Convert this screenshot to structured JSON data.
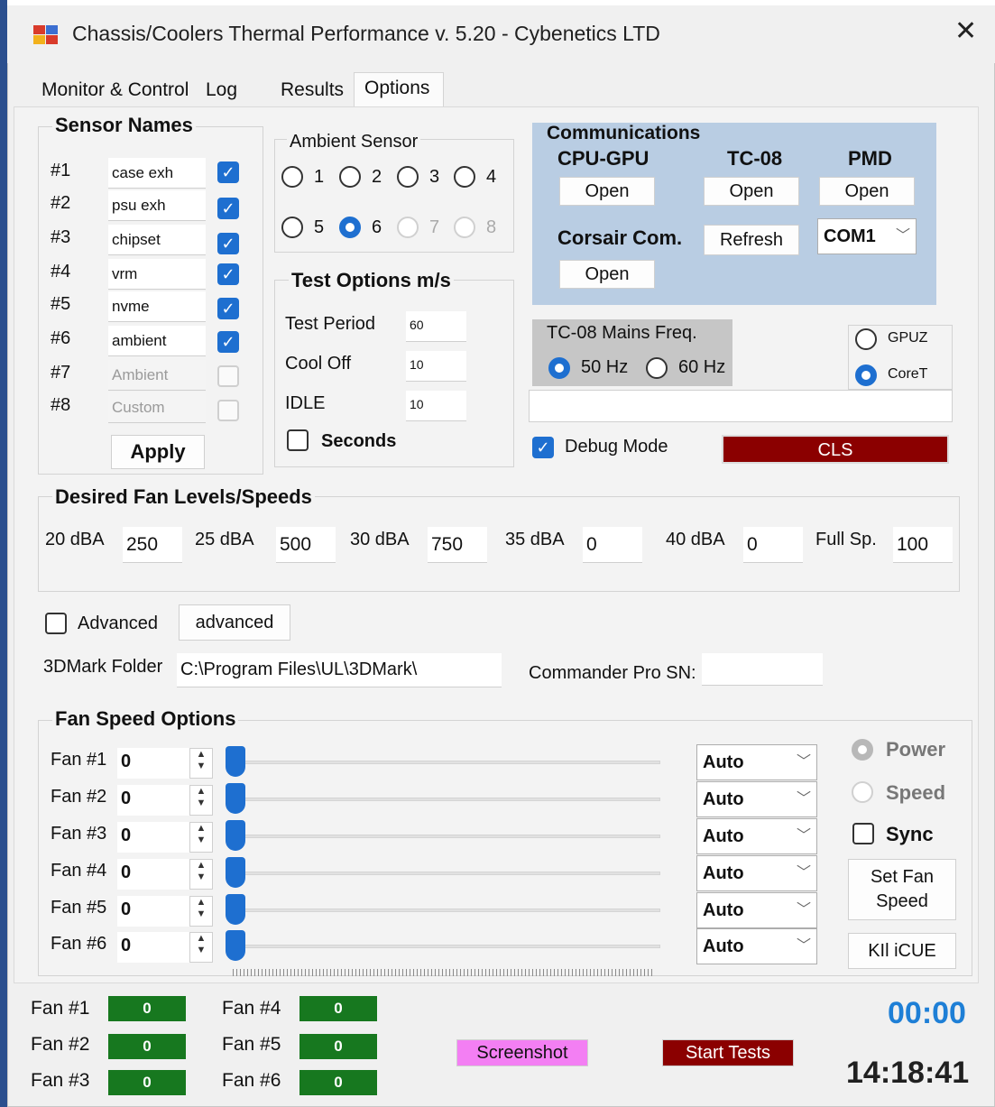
{
  "window": {
    "title": "Chassis/Coolers Thermal Performance v. 5.20 - Cybenetics LTD",
    "app_icon": "app-window-icon",
    "close_glyph": "✕"
  },
  "tabs": [
    "Monitor & Control",
    "Log",
    "Results",
    "Options"
  ],
  "active_tab": "Options",
  "sensor_names": {
    "title": "Sensor Names",
    "rows": [
      {
        "num": "#1",
        "value": "case exh",
        "checked": true
      },
      {
        "num": "#2",
        "value": "psu exh",
        "checked": true
      },
      {
        "num": "#3",
        "value": "chipset",
        "checked": true
      },
      {
        "num": "#4",
        "value": "vrm",
        "checked": true
      },
      {
        "num": "#5",
        "value": "nvme",
        "checked": true
      },
      {
        "num": "#6",
        "value": "ambient",
        "checked": true
      },
      {
        "num": "#7",
        "value": "Ambient",
        "checked": false,
        "disabled": true
      },
      {
        "num": "#8",
        "value": "Custom",
        "checked": false,
        "disabled": true
      }
    ],
    "apply_label": "Apply"
  },
  "ambient_sensor": {
    "title": "Ambient Sensor",
    "options": [
      "1",
      "2",
      "3",
      "4",
      "5",
      "6",
      "7",
      "8"
    ],
    "selected": "6"
  },
  "test_options": {
    "title": "Test Options m/s",
    "rows": [
      {
        "label": "Test Period",
        "value": "60"
      },
      {
        "label": "Cool Off",
        "value": "10"
      },
      {
        "label": "IDLE",
        "value": "10"
      }
    ],
    "seconds_label": "Seconds",
    "seconds_checked": false
  },
  "communications": {
    "title": "Communications",
    "cpu_gpu_label": "CPU-GPU",
    "tc08_label": "TC-08",
    "pmd_label": "PMD",
    "open_label": "Open",
    "corsair_label": "Corsair Com.",
    "refresh_label": "Refresh",
    "com_port": "COM1",
    "bg_color": "#b9cde3"
  },
  "mains_freq": {
    "title": "TC-08 Mains Freq.",
    "opt_50": "50 Hz",
    "opt_60": "60 Hz",
    "selected": "50 Hz"
  },
  "gpu_source": {
    "opt_gpuz": "GPUZ",
    "opt_coret": "CoreT",
    "selected": "CoreT"
  },
  "debug": {
    "label": "Debug Mode",
    "checked": true,
    "cls_label": "CLS",
    "cls_color": "#8b0000"
  },
  "desired_fan": {
    "title": "Desired Fan Levels/Speeds",
    "levels": [
      {
        "label": "20 dBA",
        "value": "250"
      },
      {
        "label": "25 dBA",
        "value": "500"
      },
      {
        "label": "30 dBA",
        "value": "750"
      },
      {
        "label": "35 dBA",
        "value": "0"
      },
      {
        "label": "40 dBA",
        "value": "0"
      },
      {
        "label": "Full Sp.",
        "value": "100"
      }
    ]
  },
  "advanced": {
    "checkbox_label": "Advanced",
    "checked": false,
    "button_label": "advanced"
  },
  "folder": {
    "label": "3DMark Folder",
    "value": "C:\\Program Files\\UL\\3DMark\\"
  },
  "commander": {
    "label": "Commander Pro SN:",
    "value": ""
  },
  "fan_speed": {
    "title": "Fan Speed Options",
    "fans": [
      {
        "label": "Fan #1",
        "value": "0",
        "mode": "Auto",
        "level": 0
      },
      {
        "label": "Fan #2",
        "value": "0",
        "mode": "Auto",
        "level": 0
      },
      {
        "label": "Fan #3",
        "value": "0",
        "mode": "Auto",
        "level": 0
      },
      {
        "label": "Fan #4",
        "value": "0",
        "mode": "Auto",
        "level": 0
      },
      {
        "label": "Fan #5",
        "value": "0",
        "mode": "Auto",
        "level": 0
      },
      {
        "label": "Fan #6",
        "value": "0",
        "mode": "Auto",
        "level": 0
      }
    ],
    "power_label": "Power",
    "speed_label": "Speed",
    "sync_label": "Sync",
    "set_fan_speed_label": "Set Fan Speed",
    "kill_icue_label": "KIl iCUE"
  },
  "status": {
    "fans": [
      {
        "label": "Fan #1",
        "value": "0"
      },
      {
        "label": "Fan #2",
        "value": "0"
      },
      {
        "label": "Fan #3",
        "value": "0"
      },
      {
        "label": "Fan #4",
        "value": "0"
      },
      {
        "label": "Fan #5",
        "value": "0"
      },
      {
        "label": "Fan #6",
        "value": "0"
      }
    ],
    "gauge_color": "#17781f",
    "screenshot_label": "Screenshot",
    "screenshot_color": "#f37ff3",
    "start_label": "Start Tests",
    "start_color": "#8b0000",
    "timer": "00:00",
    "timer_color": "#1e7fd6",
    "clock": "14:18:41"
  }
}
